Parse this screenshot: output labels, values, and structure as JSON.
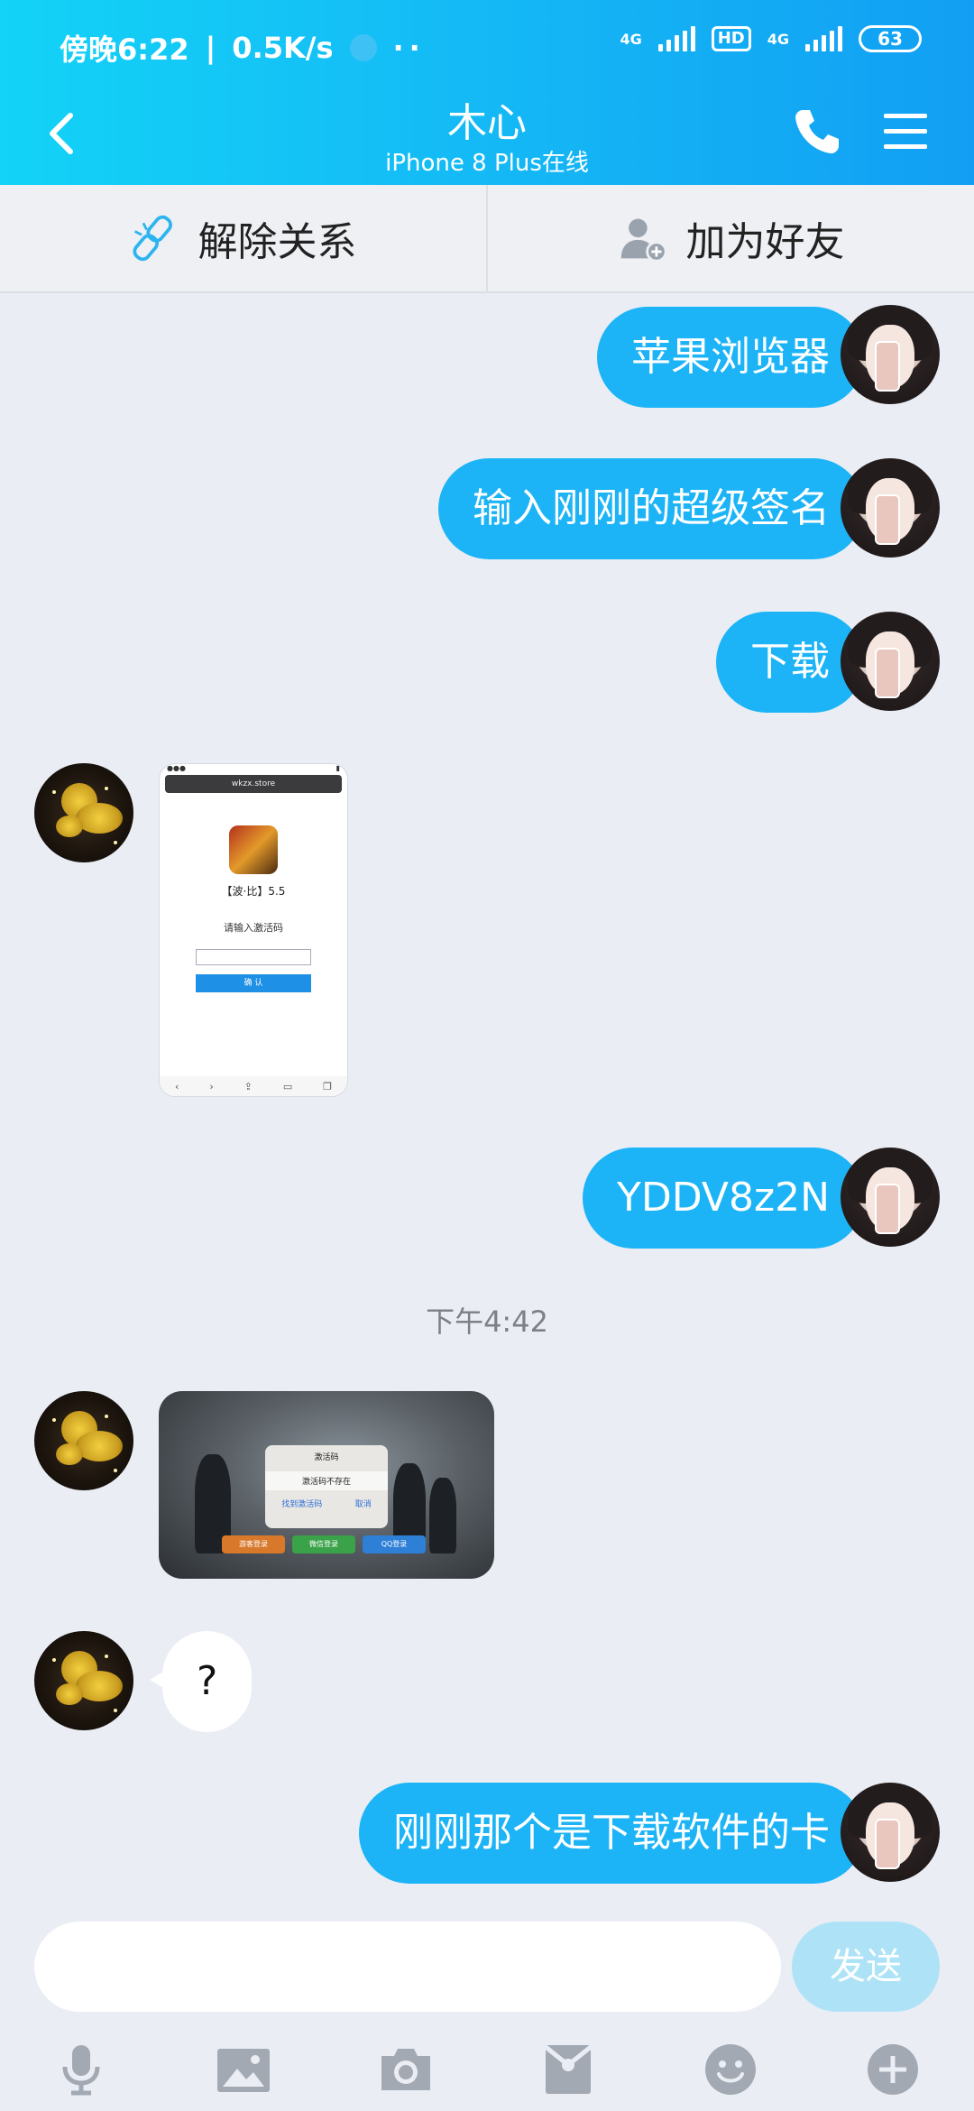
{
  "status_bar": {
    "time_label": "傍晚6:22",
    "speed_label": "0.5K/s",
    "network_1": "4G",
    "hd_badge": "HD",
    "network_2": "4G",
    "battery": "63"
  },
  "header": {
    "title": "木心",
    "subtitle": "iPhone 8 Plus在线"
  },
  "actions": {
    "unlink_label": "解除关系",
    "add_friend_label": "加为好友"
  },
  "messages": {
    "m1": "苹果浏览器",
    "m2": "输入刚刚的超级签名",
    "m3": "下载",
    "shot1": {
      "url": "wkzx.store",
      "app_name": "【波·比】5.5",
      "prompt": "请输入激活码",
      "confirm": "确 认"
    },
    "m5": "YDDV8z2N",
    "timestamp": "下午4:42",
    "shot2": {
      "dialog_title": "激活码",
      "dialog_msg": "激活码不存在",
      "action_left": "找到激活码",
      "action_right": "取消",
      "btn_1": "游客登录",
      "btn_2": "微信登录",
      "btn_3": "QQ登录"
    },
    "m7": "?",
    "m8": "刚刚那个是下载软件的卡"
  },
  "input": {
    "value": "",
    "send_label": "发送"
  },
  "toolbar": {
    "icons": [
      "microphone-icon",
      "image-icon",
      "camera-icon",
      "red-packet-icon",
      "emoji-icon",
      "plus-icon"
    ]
  },
  "colors": {
    "header_start": "#13d3f7",
    "header_end": "#129ff3",
    "bubble_out": "#1cb4f6",
    "background": "#eaedf4",
    "send_disabled": "#aee3f7"
  }
}
